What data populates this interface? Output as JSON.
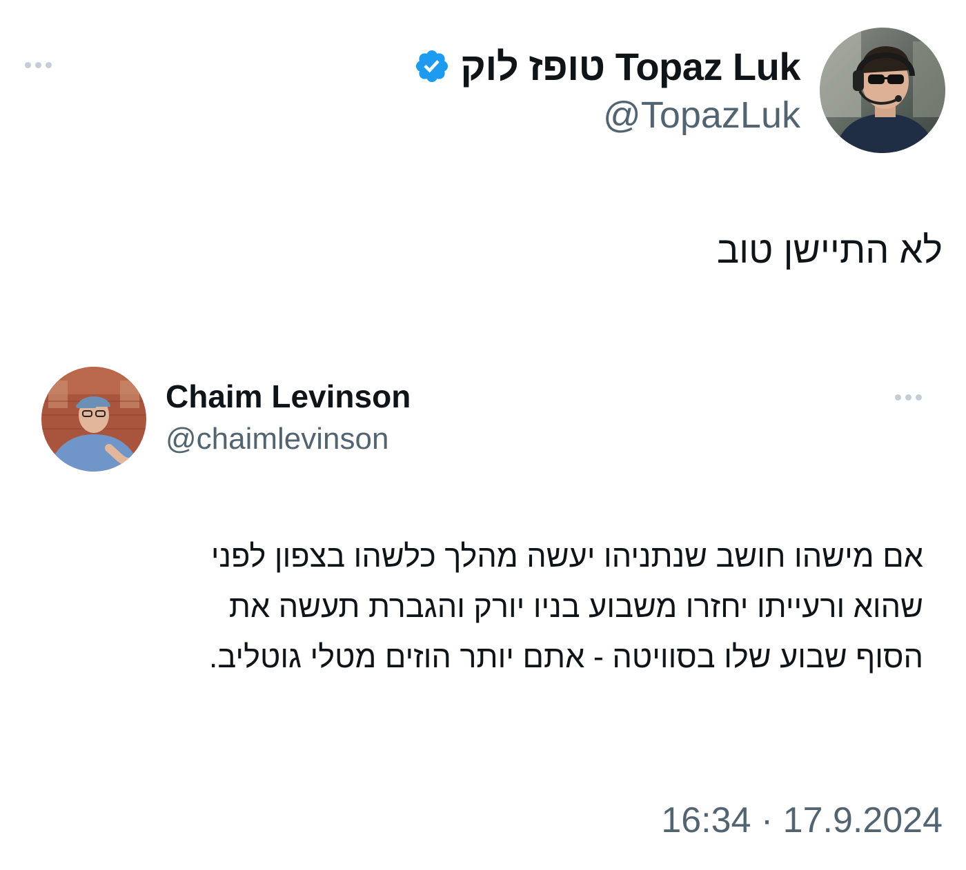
{
  "main_tweet": {
    "author_name": "טופז לוק Topaz Luk",
    "handle": "@TopazLuk",
    "verified": true,
    "text": "לא התיישן טוב",
    "timestamp": "16:34 · 17.9.2024"
  },
  "quoted_tweet": {
    "author_name": "Chaim Levinson",
    "handle": "@chaimlevinson",
    "text_lines": [
      "אם מישהו חושב שנתניהו יעשה מהלך כלשהו בצפון לפני",
      "שהוא ורעייתו יחזרו משבוע בניו יורק והגברת תעשה את",
      "הסוף שבוע שלו בסוויטה - אתם יותר הוזים מטלי גוטליב."
    ]
  },
  "icons": {
    "verified": "verified-badge-icon",
    "more": "more-options-icon"
  },
  "colors": {
    "verified": "#1d9bf0",
    "text_primary": "#0f1419",
    "text_secondary": "#536471",
    "more_dots": "#c4cdd5"
  }
}
